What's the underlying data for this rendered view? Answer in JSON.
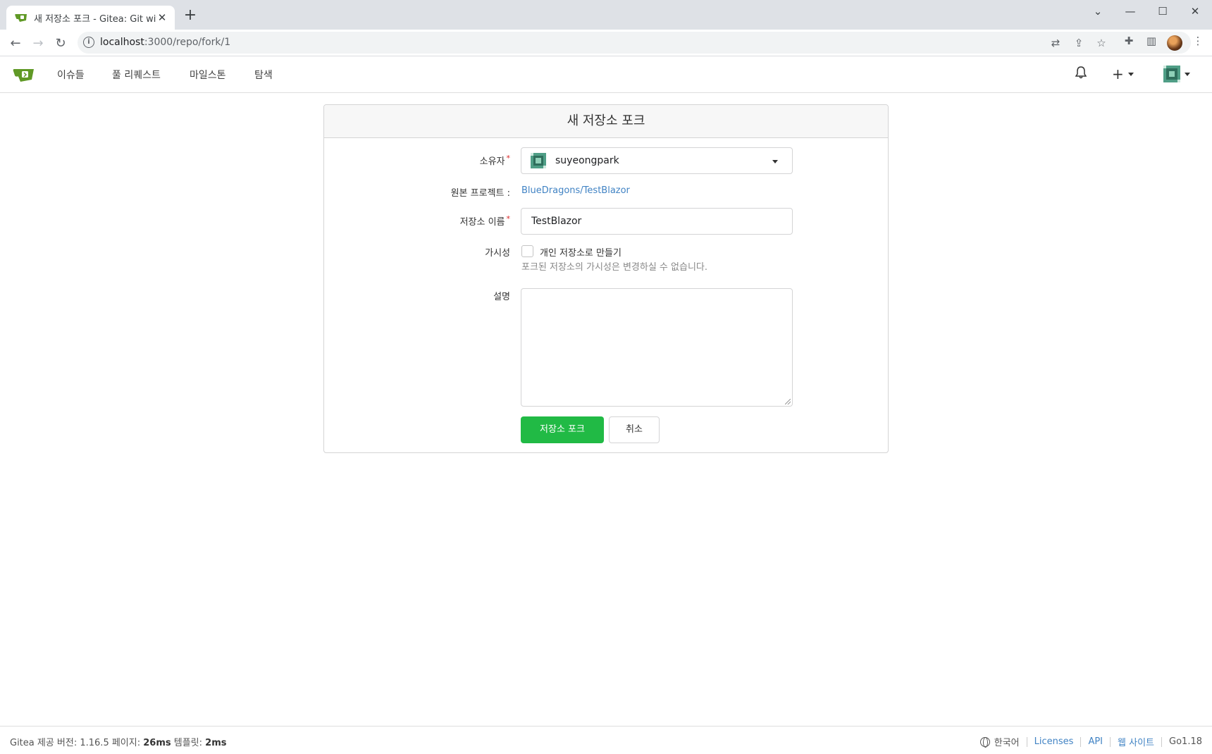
{
  "browser": {
    "tab_title": "새 저장소 포크 - Gitea: Git with a cup of tea",
    "url_host": "localhost",
    "url_path": ":3000/repo/fork/1"
  },
  "nav": {
    "items": [
      "이슈들",
      "풀 리퀘스트",
      "마일스톤",
      "탐색"
    ]
  },
  "form": {
    "heading": "새 저장소 포크",
    "owner_label": "소유자",
    "owner_value": "suyeongpark",
    "source_label": "원본 프로젝트 :",
    "source_link": "BlueDragons/TestBlazor",
    "repo_name_label": "저장소 이름",
    "repo_name_value": "TestBlazor",
    "visibility_label": "가시성",
    "private_label": "개인 저장소로 만들기",
    "visibility_help": "포크된 저장소의 가시성은 변경하실 수 없습니다.",
    "description_label": "설명",
    "description_value": "",
    "submit_label": "저장소 포크",
    "cancel_label": "취소"
  },
  "footer": {
    "powered_prefix": "Gitea 제공 버전: 1.16.5 페이지: ",
    "page_time": "26ms",
    "template_prefix": " 템플릿: ",
    "template_time": "2ms",
    "language": "한국어",
    "licenses": "Licenses",
    "api": "API",
    "website": "웹 사이트",
    "go_version": "Go1.18"
  },
  "colors": {
    "primary_green": "#21ba45",
    "link_blue": "#4183c4",
    "gitea_green": "#609926"
  }
}
